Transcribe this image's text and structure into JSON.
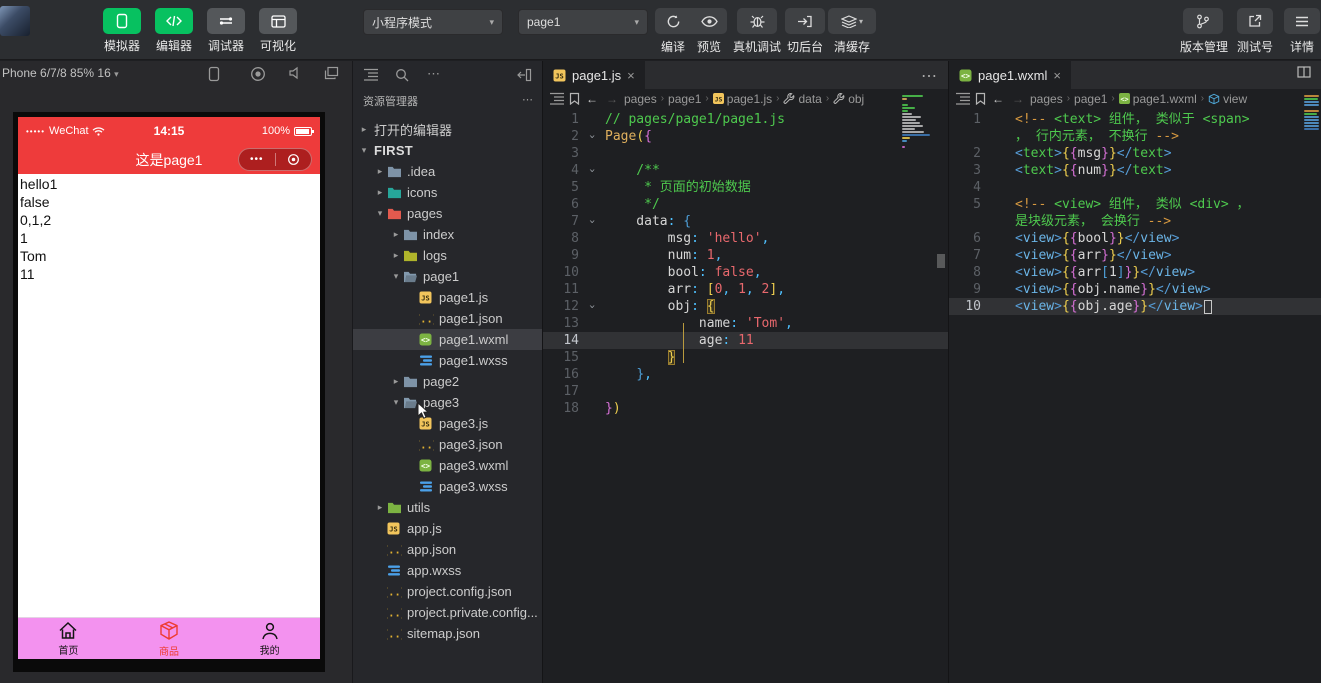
{
  "colors": {
    "accent_green": "#07C160",
    "nav_red": "#EE3B3B",
    "tabbar_pink": "#F392EF",
    "tab_active_red": "#EE3B30",
    "editor_bg": "#1e1f22",
    "selection_gray": "#3c3d42"
  },
  "toolbar": {
    "left_buttons": [
      {
        "label": "模拟器",
        "style": "green",
        "icon": "simulator"
      },
      {
        "label": "编辑器",
        "style": "green",
        "icon": "code"
      },
      {
        "label": "调试器",
        "style": "gray",
        "icon": "debugger"
      },
      {
        "label": "可视化",
        "style": "gray",
        "icon": "layout"
      }
    ],
    "mode_select": "小程序模式",
    "page_select": "page1",
    "compile_group": [
      {
        "label": "编译",
        "icon": "refresh"
      },
      {
        "label": "预览",
        "icon": "eye"
      }
    ],
    "action_buttons": [
      {
        "label": "真机调试",
        "icon": "bug"
      },
      {
        "label": "切后台",
        "icon": "background"
      },
      {
        "label": "清缓存",
        "icon": "layers",
        "dropdown": "▾"
      }
    ],
    "right_buttons": [
      {
        "label": "版本管理",
        "icon": "branch"
      },
      {
        "label": "测试号",
        "icon": "external"
      },
      {
        "label": "详情",
        "icon": "menu"
      }
    ],
    "caret": "▾"
  },
  "simulator": {
    "device_label": "Phone 6/7/8 85% 16",
    "device_caret": "▾",
    "status": {
      "signal": "•••••",
      "carrier": "WeChat",
      "time": "14:15",
      "battery": "100%"
    },
    "nav_title": "这是page1",
    "capsule_dots": "•••",
    "content_lines": [
      "hello1",
      "false",
      "0,1,2",
      "1",
      "Tom",
      "11"
    ],
    "tabbar": [
      {
        "label": "首页",
        "icon": "home",
        "active": false
      },
      {
        "label": "商品",
        "icon": "cube",
        "active": true
      },
      {
        "label": "我的",
        "icon": "user",
        "active": false
      }
    ]
  },
  "explorer": {
    "header": "资源管理器",
    "more": "⋯",
    "items": [
      {
        "label": "打开的编辑器",
        "icon": null,
        "indent": 0,
        "expand": "closed"
      },
      {
        "label": "FIRST",
        "icon": null,
        "indent": 0,
        "expand": "open",
        "bold": true
      },
      {
        "label": ".idea",
        "icon": "folder",
        "indent": 1,
        "expand": "closed"
      },
      {
        "label": "icons",
        "icon": "folder-icons",
        "indent": 1,
        "expand": "closed"
      },
      {
        "label": "pages",
        "icon": "folder-pages",
        "indent": 1,
        "expand": "open"
      },
      {
        "label": "index",
        "icon": "folder",
        "indent": 2,
        "expand": "closed"
      },
      {
        "label": "logs",
        "icon": "folder-logs",
        "indent": 2,
        "expand": "closed"
      },
      {
        "label": "page1",
        "icon": "folder-open",
        "indent": 2,
        "expand": "open"
      },
      {
        "label": "page1.js",
        "icon": "file-js",
        "indent": 3
      },
      {
        "label": "page1.json",
        "icon": "file-json",
        "indent": 3
      },
      {
        "label": "page1.wxml",
        "icon": "file-wxml",
        "indent": 3,
        "selected": true
      },
      {
        "label": "page1.wxss",
        "icon": "file-wxss",
        "indent": 3
      },
      {
        "label": "page2",
        "icon": "folder",
        "indent": 2,
        "expand": "closed"
      },
      {
        "label": "page3",
        "icon": "folder-open",
        "indent": 2,
        "expand": "open",
        "cursor": true
      },
      {
        "label": "page3.js",
        "icon": "file-js",
        "indent": 3
      },
      {
        "label": "page3.json",
        "icon": "file-json",
        "indent": 3
      },
      {
        "label": "page3.wxml",
        "icon": "file-wxml",
        "indent": 3
      },
      {
        "label": "page3.wxss",
        "icon": "file-wxss",
        "indent": 3
      },
      {
        "label": "utils",
        "icon": "folder-utils",
        "indent": 1,
        "expand": "closed"
      },
      {
        "label": "app.js",
        "icon": "file-js",
        "indent": 1
      },
      {
        "label": "app.json",
        "icon": "file-json",
        "indent": 1
      },
      {
        "label": "app.wxss",
        "icon": "file-wxss",
        "indent": 1
      },
      {
        "label": "project.config.json",
        "icon": "file-json",
        "indent": 1
      },
      {
        "label": "project.private.config...",
        "icon": "file-json",
        "indent": 1
      },
      {
        "label": "sitemap.json",
        "icon": "file-json",
        "indent": 1
      }
    ]
  },
  "editor1": {
    "tab": "page1.js",
    "tab_icon": "file-js",
    "close": "×",
    "more": "⋯",
    "breadcrumbs": [
      {
        "label": "pages"
      },
      {
        "label": "page1"
      },
      {
        "label": "page1.js",
        "icon": "js-mini"
      },
      {
        "label": "data",
        "icon": "wrench"
      },
      {
        "label": "obj",
        "icon": "wrench"
      }
    ],
    "lines": [
      {
        "no": 1,
        "tokens": [
          [
            "cmt",
            "// pages/page1/page1.js"
          ]
        ]
      },
      {
        "no": 2,
        "fold": true,
        "tokens": [
          [
            "fn",
            "Page"
          ],
          [
            "by",
            "("
          ],
          [
            "bp",
            "{"
          ]
        ]
      },
      {
        "no": 3,
        "tokens": []
      },
      {
        "no": 4,
        "fold": true,
        "tokens": [
          [
            "cmt",
            "    /**"
          ]
        ]
      },
      {
        "no": 5,
        "tokens": [
          [
            "cmt",
            "     * 页面的初始数据"
          ]
        ]
      },
      {
        "no": 6,
        "tokens": [
          [
            "cmt",
            "     */"
          ]
        ]
      },
      {
        "no": 7,
        "fold": true,
        "tokens": [
          [
            "w",
            "    data"
          ],
          [
            "pu",
            ":"
          ],
          [
            "w",
            " "
          ],
          [
            "bb",
            "{"
          ]
        ]
      },
      {
        "no": 8,
        "tokens": [
          [
            "w",
            "        msg"
          ],
          [
            "pu",
            ":"
          ],
          [
            "w",
            " "
          ],
          [
            "r",
            "'hello'"
          ],
          [
            "pu",
            ","
          ]
        ]
      },
      {
        "no": 9,
        "tokens": [
          [
            "w",
            "        num"
          ],
          [
            "pu",
            ":"
          ],
          [
            "w",
            " "
          ],
          [
            "r",
            "1"
          ],
          [
            "pu",
            ","
          ]
        ]
      },
      {
        "no": 10,
        "tokens": [
          [
            "w",
            "        bool"
          ],
          [
            "pu",
            ":"
          ],
          [
            "w",
            " "
          ],
          [
            "r",
            "false"
          ],
          [
            "pu",
            ","
          ]
        ]
      },
      {
        "no": 11,
        "tokens": [
          [
            "w",
            "        arr"
          ],
          [
            "pu",
            ":"
          ],
          [
            "w",
            " "
          ],
          [
            "by",
            "["
          ],
          [
            "r",
            "0"
          ],
          [
            "pu",
            ","
          ],
          [
            "w",
            " "
          ],
          [
            "r",
            "1"
          ],
          [
            "pu",
            ","
          ],
          [
            "w",
            " "
          ],
          [
            "r",
            "2"
          ],
          [
            "by",
            "]"
          ],
          [
            "pu",
            ","
          ]
        ]
      },
      {
        "no": 12,
        "fold": true,
        "tokens": [
          [
            "w",
            "        obj"
          ],
          [
            "pu",
            ":"
          ],
          [
            "w",
            " "
          ],
          [
            "byx",
            "{"
          ]
        ]
      },
      {
        "no": 13,
        "tokens": [
          [
            "w",
            "            name"
          ],
          [
            "pu",
            ":"
          ],
          [
            "w",
            " "
          ],
          [
            "r",
            "'Tom'"
          ],
          [
            "pu",
            ","
          ]
        ]
      },
      {
        "no": 14,
        "hl": true,
        "cur": true,
        "tokens": [
          [
            "w",
            "            age"
          ],
          [
            "pu",
            ":"
          ],
          [
            "w",
            " "
          ],
          [
            "r",
            "11"
          ]
        ]
      },
      {
        "no": 15,
        "tokens": [
          [
            "w",
            "        "
          ],
          [
            "byx",
            "}"
          ]
        ]
      },
      {
        "no": 16,
        "tokens": [
          [
            "w",
            "    "
          ],
          [
            "bb",
            "}"
          ],
          [
            "pu",
            ","
          ]
        ]
      },
      {
        "no": 17,
        "tokens": []
      },
      {
        "no": 18,
        "tokens": [
          [
            "bp",
            "}"
          ],
          [
            "by",
            ")"
          ]
        ]
      }
    ]
  },
  "editor2": {
    "tab": "page1.wxml",
    "tab_icon": "file-wxml",
    "close": "×",
    "breadcrumbs": [
      {
        "label": "pages"
      },
      {
        "label": "page1"
      },
      {
        "label": "page1.wxml",
        "icon": "wxml-mini"
      },
      {
        "label": "view",
        "icon": "cube-sym"
      }
    ],
    "lines": [
      {
        "no": 1,
        "tokens": [
          [
            "cd",
            "<!--"
          ],
          [
            "cmt",
            " <text> 组件， 类似于 <span>"
          ]
        ]
      },
      {
        "no": null,
        "tokens": [
          [
            "cmt",
            "， 行内元素， 不换行 "
          ],
          [
            "cd",
            "-->"
          ]
        ]
      },
      {
        "no": 2,
        "tokens": [
          [
            "tb",
            "<"
          ],
          [
            "tg",
            "text"
          ],
          [
            "tb",
            ">"
          ],
          [
            "by",
            "{"
          ],
          [
            "bp",
            "{"
          ],
          [
            "w",
            "msg"
          ],
          [
            "bp",
            "}"
          ],
          [
            "by",
            "}"
          ],
          [
            "tb",
            "</"
          ],
          [
            "tg",
            "text"
          ],
          [
            "tb",
            ">"
          ]
        ]
      },
      {
        "no": 3,
        "tokens": [
          [
            "tb",
            "<"
          ],
          [
            "tg",
            "text"
          ],
          [
            "tb",
            ">"
          ],
          [
            "by",
            "{"
          ],
          [
            "bp",
            "{"
          ],
          [
            "w",
            "num"
          ],
          [
            "bp",
            "}"
          ],
          [
            "by",
            "}"
          ],
          [
            "tb",
            "</"
          ],
          [
            "tg",
            "text"
          ],
          [
            "tb",
            ">"
          ]
        ]
      },
      {
        "no": 4,
        "tokens": []
      },
      {
        "no": 5,
        "tokens": [
          [
            "cd",
            "<!--"
          ],
          [
            "cmt",
            " <view> 组件， 类似 <div> ，"
          ]
        ]
      },
      {
        "no": null,
        "tokens": [
          [
            "cmt",
            "是块级元素， 会换行 "
          ],
          [
            "cd",
            "-->"
          ]
        ]
      },
      {
        "no": 6,
        "tokens": [
          [
            "tb",
            "<"
          ],
          [
            "tv",
            "view"
          ],
          [
            "tb",
            ">"
          ],
          [
            "by",
            "{"
          ],
          [
            "bp",
            "{"
          ],
          [
            "w",
            "bool"
          ],
          [
            "bp",
            "}"
          ],
          [
            "by",
            "}"
          ],
          [
            "tb",
            "</"
          ],
          [
            "tv",
            "view"
          ],
          [
            "tb",
            ">"
          ]
        ]
      },
      {
        "no": 7,
        "tokens": [
          [
            "tb",
            "<"
          ],
          [
            "tv",
            "view"
          ],
          [
            "tb",
            ">"
          ],
          [
            "by",
            "{"
          ],
          [
            "bp",
            "{"
          ],
          [
            "w",
            "arr"
          ],
          [
            "bp",
            "}"
          ],
          [
            "by",
            "}"
          ],
          [
            "tb",
            "</"
          ],
          [
            "tv",
            "view"
          ],
          [
            "tb",
            ">"
          ]
        ]
      },
      {
        "no": 8,
        "tokens": [
          [
            "tb",
            "<"
          ],
          [
            "tv",
            "view"
          ],
          [
            "tb",
            ">"
          ],
          [
            "by",
            "{"
          ],
          [
            "bp",
            "{"
          ],
          [
            "w",
            "arr"
          ],
          [
            "bb",
            "["
          ],
          [
            "w",
            "1"
          ],
          [
            "bb",
            "]"
          ],
          [
            "bp",
            "}"
          ],
          [
            "by",
            "}"
          ],
          [
            "tb",
            "</"
          ],
          [
            "tv",
            "view"
          ],
          [
            "tb",
            ">"
          ]
        ]
      },
      {
        "no": 9,
        "tokens": [
          [
            "tb",
            "<"
          ],
          [
            "tv",
            "view"
          ],
          [
            "tb",
            ">"
          ],
          [
            "by",
            "{"
          ],
          [
            "bp",
            "{"
          ],
          [
            "w",
            "obj.name"
          ],
          [
            "bp",
            "}"
          ],
          [
            "by",
            "}"
          ],
          [
            "tb",
            "</"
          ],
          [
            "tv",
            "view"
          ],
          [
            "tb",
            ">"
          ]
        ]
      },
      {
        "no": 10,
        "hl": true,
        "cur": true,
        "cursor": true,
        "tokens": [
          [
            "tb",
            "<"
          ],
          [
            "tv",
            "view"
          ],
          [
            "tb",
            ">"
          ],
          [
            "by",
            "{"
          ],
          [
            "bp",
            "{"
          ],
          [
            "w",
            "obj.age"
          ],
          [
            "bp",
            "}"
          ],
          [
            "by",
            "}"
          ],
          [
            "tb",
            "</"
          ],
          [
            "tv",
            "view"
          ],
          [
            "tb",
            ">"
          ]
        ]
      }
    ]
  }
}
